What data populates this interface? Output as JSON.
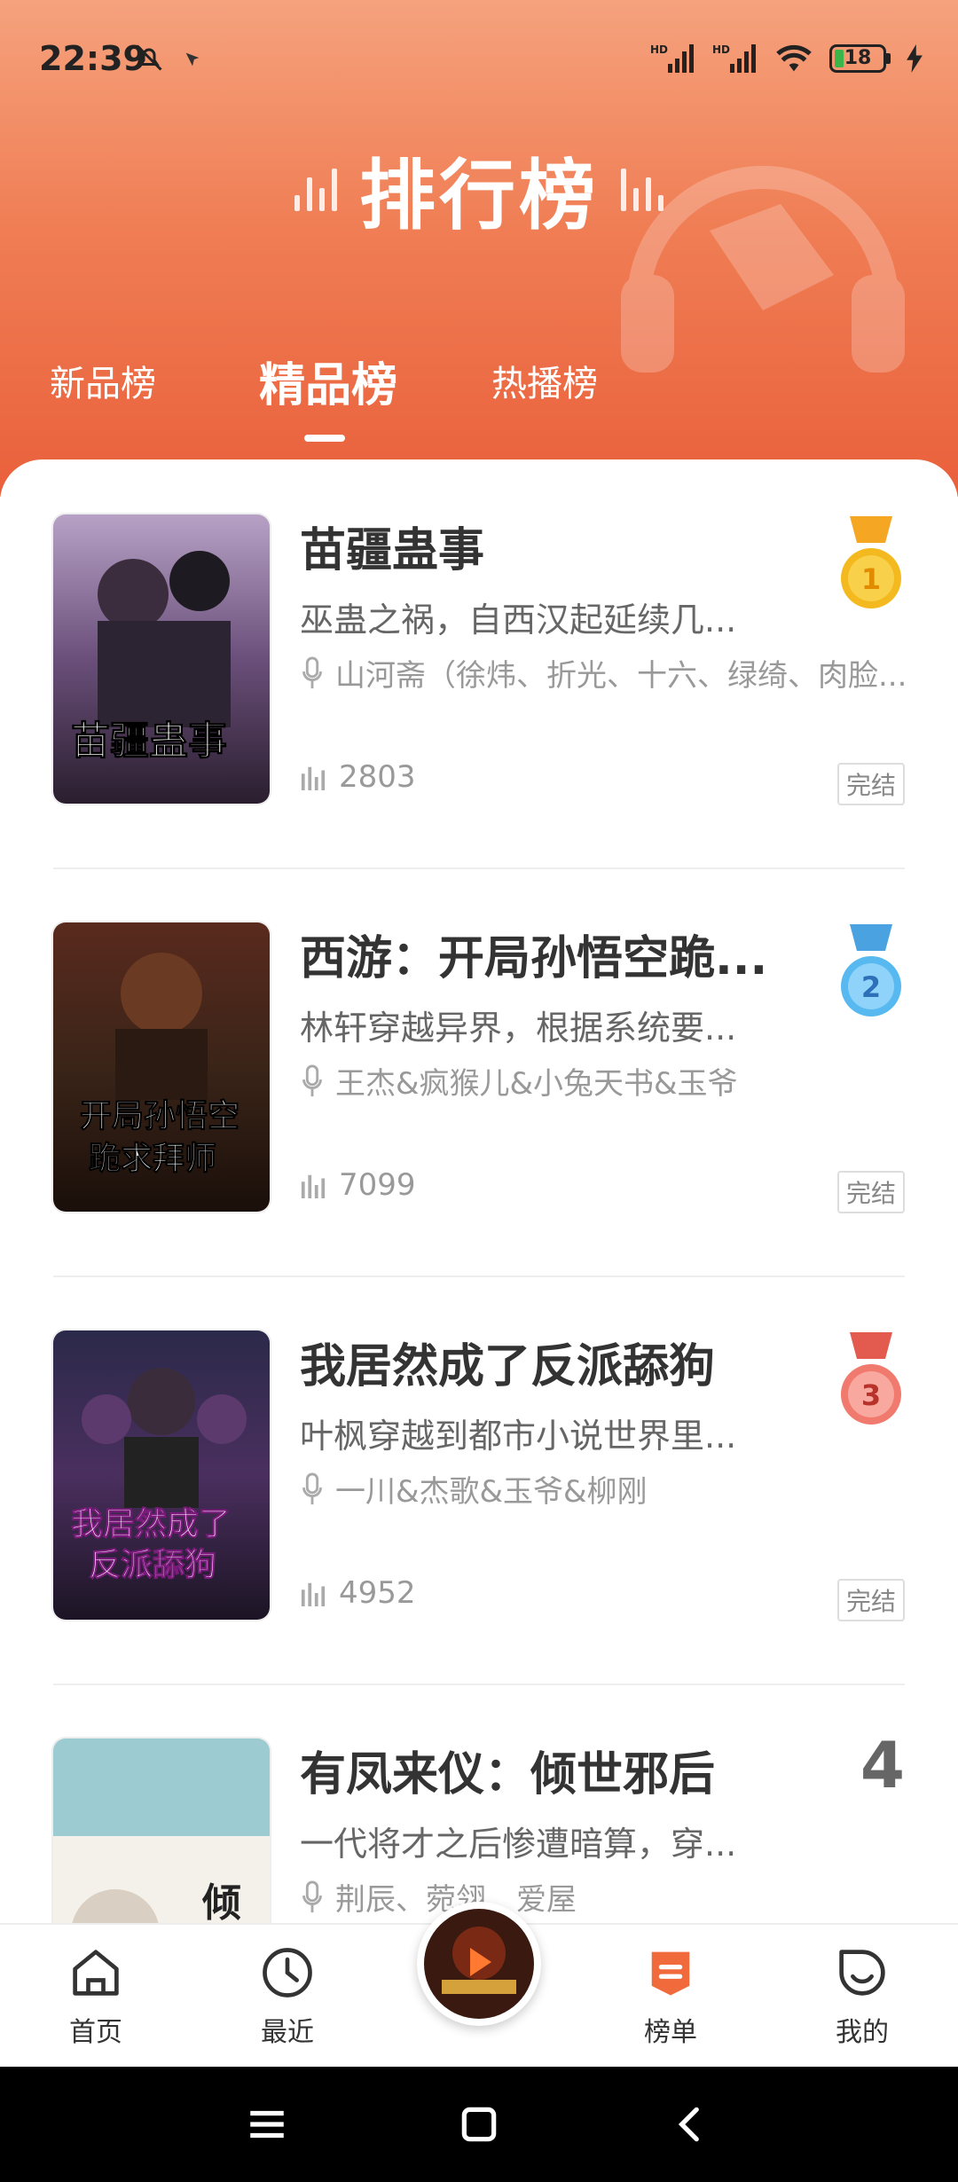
{
  "status_bar": {
    "time": "22:39",
    "battery": "18"
  },
  "header": {
    "title": "排行榜"
  },
  "tabs": [
    {
      "label": "新品榜",
      "active": false
    },
    {
      "label": "精品榜",
      "active": true
    },
    {
      "label": "热播榜",
      "active": false
    }
  ],
  "books": [
    {
      "rank": "1",
      "title": "苗疆蛊事",
      "desc": "巫蛊之祸，自西汉起延续几...",
      "narrators": "山河斋（徐炜、折光、十六、绿绮、肉脸...",
      "plays": "2803",
      "status": "完结",
      "medal_color": "#f3b91f"
    },
    {
      "rank": "2",
      "title": "西游：开局孙悟空跪...",
      "desc": "林轩穿越异界，根据系统要...",
      "narrators": "王杰&疯猴儿&小兔天书&玉爷",
      "plays": "7099",
      "status": "完结",
      "medal_color": "#58b8f0"
    },
    {
      "rank": "3",
      "title": "我居然成了反派舔狗",
      "desc": "叶枫穿越到都市小说世界里...",
      "narrators": "一川&杰歌&玉爷&柳刚",
      "plays": "4952",
      "status": "完结",
      "medal_color": "#f07a6e"
    },
    {
      "rank": "4",
      "title": "有凤来仪：倾世邪后",
      "desc": "一代将才之后惨遭暗算，穿...",
      "narrators": "荆辰、菀翎、爱屋"
    }
  ],
  "bottom_nav": [
    {
      "label": "首页",
      "icon": "home-icon"
    },
    {
      "label": "最近",
      "icon": "clock-icon"
    },
    {
      "label": "榜单",
      "icon": "ranking-icon",
      "active": true
    },
    {
      "label": "我的",
      "icon": "profile-icon"
    }
  ],
  "colors": {
    "header_top": "#f5a27d",
    "header_bottom": "#e9603b",
    "accent": "#f06a3c"
  }
}
